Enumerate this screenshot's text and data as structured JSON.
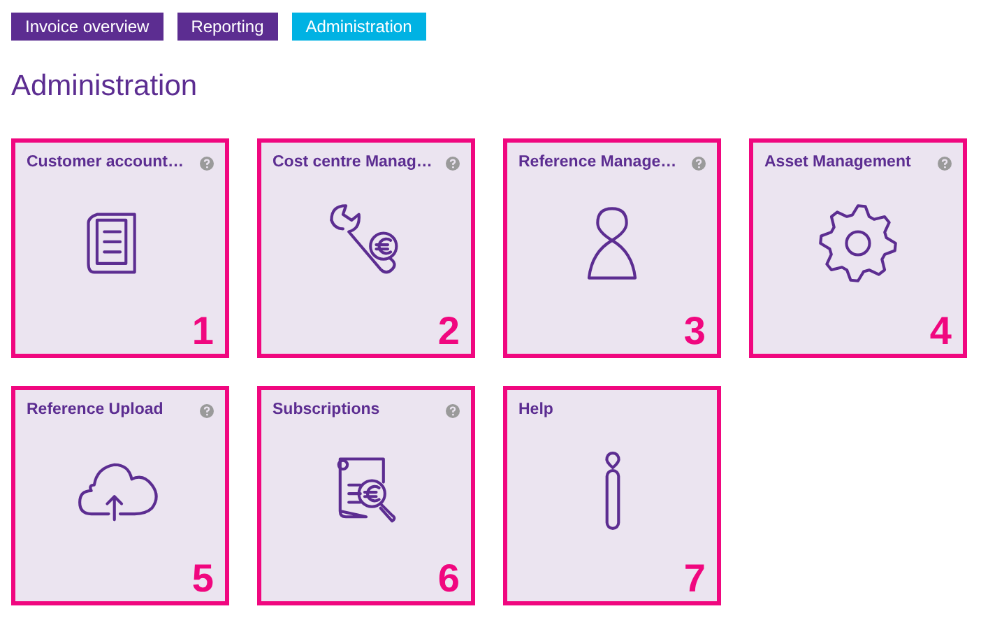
{
  "tabs": [
    {
      "label": "Invoice overview",
      "selected": false
    },
    {
      "label": "Reporting",
      "selected": false
    },
    {
      "label": "Administration",
      "selected": true
    }
  ],
  "heading": "Administration",
  "tiles": [
    {
      "title": "Customer account…",
      "help": true,
      "kind": "document",
      "number": "1"
    },
    {
      "title": "Cost centre Manag…",
      "help": true,
      "kind": "wrench",
      "number": "2"
    },
    {
      "title": "Reference Manage…",
      "help": true,
      "kind": "person",
      "number": "3"
    },
    {
      "title": "Asset Management",
      "help": true,
      "kind": "gear",
      "number": "4"
    },
    {
      "title": "Reference Upload",
      "help": true,
      "kind": "upload",
      "number": "5"
    },
    {
      "title": "Subscriptions",
      "help": true,
      "kind": "invoice",
      "number": "6"
    },
    {
      "title": "Help",
      "help": false,
      "kind": "info",
      "number": "7"
    }
  ]
}
